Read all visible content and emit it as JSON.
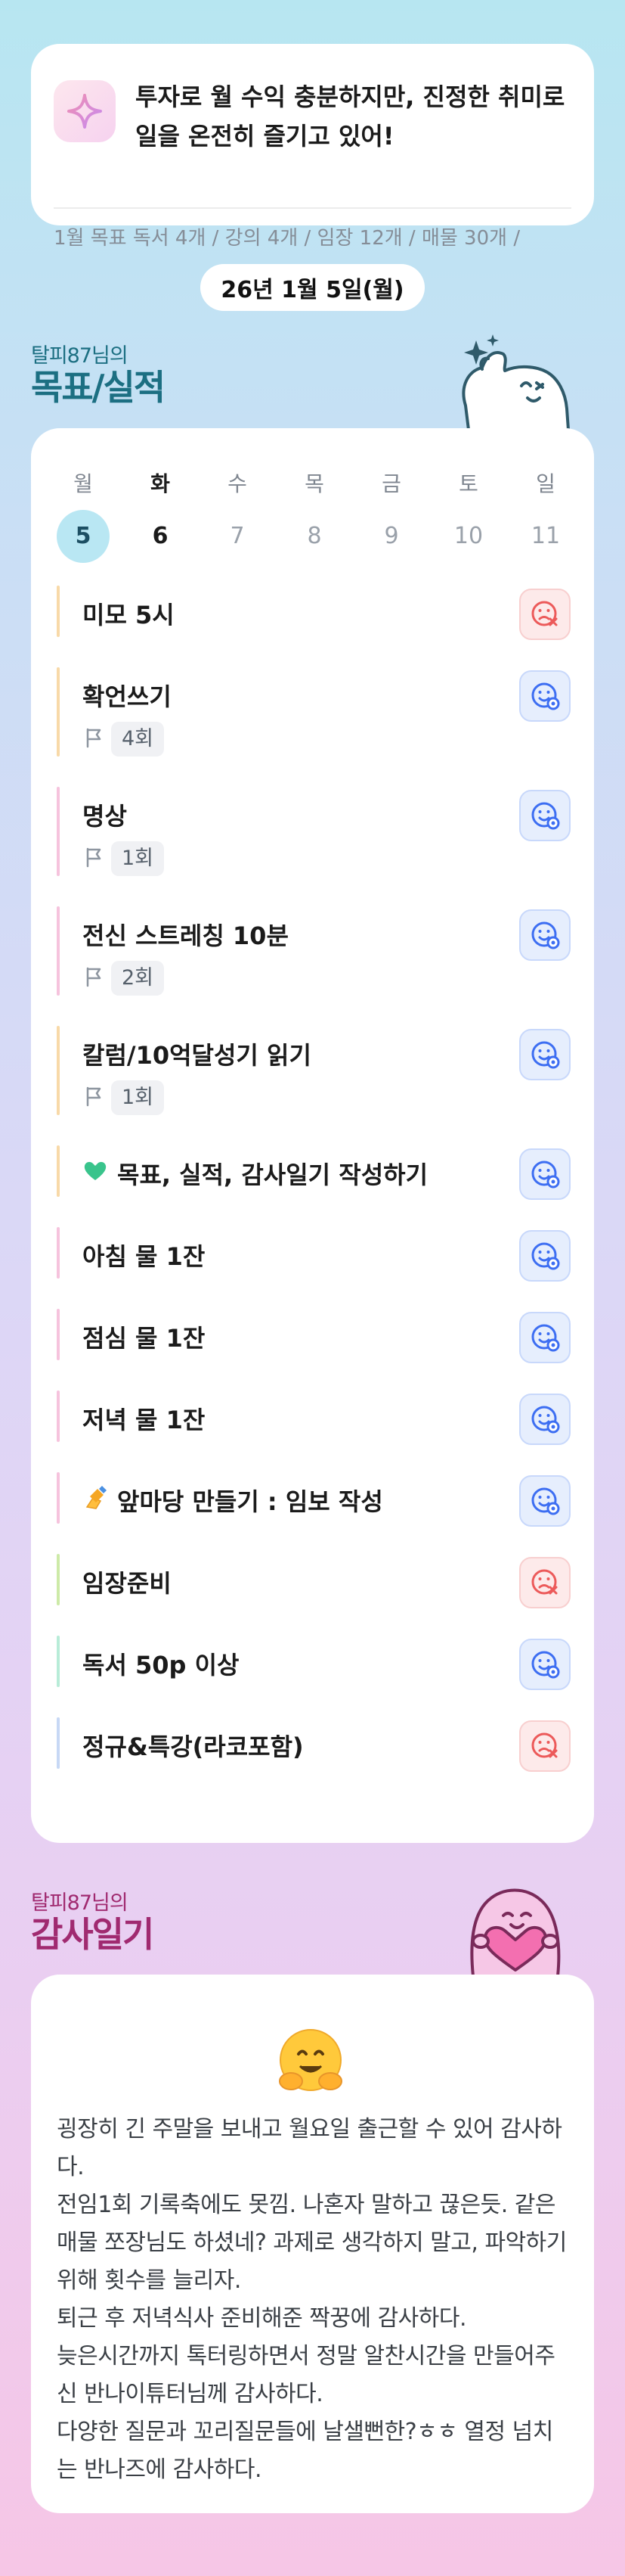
{
  "goal": {
    "icon": "sparkle-icon",
    "text": "투자로 월 수익 충분하지만, 진정한 취미로 일을 온전히 즐기고 있어!",
    "sub": "1월 목표  독서 4개 / 강의 4개 / 임장 12개 / 매물 30개 /"
  },
  "date_label": "26년 1월 5일(월)",
  "goals_section": {
    "owner": "탈피87님의",
    "title": "목표/실적"
  },
  "week": {
    "days": [
      "월",
      "화",
      "수",
      "목",
      "금",
      "토",
      "일"
    ],
    "dates": [
      "5",
      "6",
      "7",
      "8",
      "9",
      "10",
      "11"
    ],
    "selected_index": 0,
    "today_index": 1
  },
  "tasks": [
    {
      "name": "미모 5시",
      "status": "fail",
      "bar": "#f8d9a8"
    },
    {
      "name": "확언쓰기",
      "count": "4회",
      "status": "ok",
      "bar": "#f8d9a8"
    },
    {
      "name": "명상",
      "count": "1회",
      "status": "ok",
      "bar": "#f6c3dd"
    },
    {
      "name": "전신 스트레칭 10분",
      "count": "2회",
      "status": "ok",
      "bar": "#f6c3dd"
    },
    {
      "name": "칼럼/10억달성기 읽기",
      "count": "1회",
      "status": "ok",
      "bar": "#f8d9a8"
    },
    {
      "name": "목표, 실적, 감사일기 작성하기",
      "emoji": "green-heart",
      "status": "ok",
      "bar": "#f8d9a8"
    },
    {
      "name": "아침 물 1잔",
      "status": "ok",
      "bar": "#f6c3dd"
    },
    {
      "name": "점심 물 1잔",
      "status": "ok",
      "bar": "#f6c3dd"
    },
    {
      "name": "저녁 물 1잔",
      "status": "ok",
      "bar": "#f6c3dd"
    },
    {
      "name": "앞마당 만들기 : 임보 작성",
      "emoji": "writing-hand",
      "status": "ok",
      "bar": "#f6c3dd"
    },
    {
      "name": "임장준비",
      "status": "fail",
      "bar": "#cdeaa8"
    },
    {
      "name": "독서 50p 이상",
      "status": "ok",
      "bar": "#b8ecd8"
    },
    {
      "name": "정규&특강(라코포함)",
      "status": "fail",
      "bar": "#c7d8f5"
    }
  ],
  "diary_section": {
    "owner": "탈피87님의",
    "title": "감사일기"
  },
  "diary": {
    "emoji": "hugging-face-emoji",
    "text": "굉장히 긴 주말을 보내고 월요일 출근할 수 있어 감사하다.\n전임1회 기록축에도 못낌. 나혼자 말하고 끊은듯. 같은 매물 쪼장님도 하셨네? 과제로 생각하지 말고, 파악하기 위해 횟수를 늘리자.\n퇴근 후 저녁식사 준비해준 짝꿍에 감사하다.\n늦은시간까지 톡터링하면서 정말 알찬시간을 만들어주신 반나이튜터님께 감사하다.\n다양한 질문과 꼬리질문들에 날샐뻔한?ㅎㅎ 열정 넘치는 반나즈에 감사하다."
  },
  "colors": {
    "accent_teal": "#1c6f82",
    "accent_magenta": "#a02a70",
    "ok_blue": "#3d6ef2",
    "fail_red": "#ec5a5a"
  }
}
